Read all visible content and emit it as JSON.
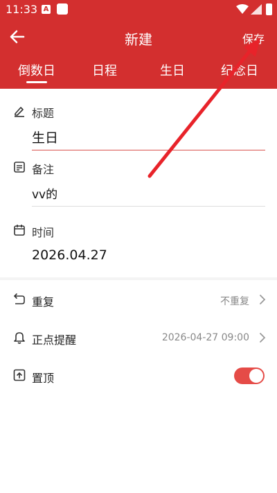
{
  "status_bar": {
    "time": "11:33",
    "notification_letter": "A"
  },
  "header": {
    "title": "新建",
    "save_label": "保存"
  },
  "tabs": [
    {
      "label": "倒数日",
      "active": true
    },
    {
      "label": "日程",
      "active": false
    },
    {
      "label": "生日",
      "active": false
    },
    {
      "label": "纪念日",
      "active": false
    }
  ],
  "form": {
    "title_label": "标题",
    "title_value": "生日",
    "note_label": "备注",
    "note_value": "vv的",
    "time_label": "时间",
    "time_value": "2026.04.27"
  },
  "settings": {
    "repeat_label": "重复",
    "repeat_value": "不重复",
    "reminder_label": "正点提醒",
    "reminder_value": "2026-04-27 09:00",
    "pin_label": "置顶",
    "pin_enabled": true
  },
  "colors": {
    "header": "#d32f2f",
    "accent": "#e54b47",
    "annotation_arrow": "#e8232a"
  }
}
